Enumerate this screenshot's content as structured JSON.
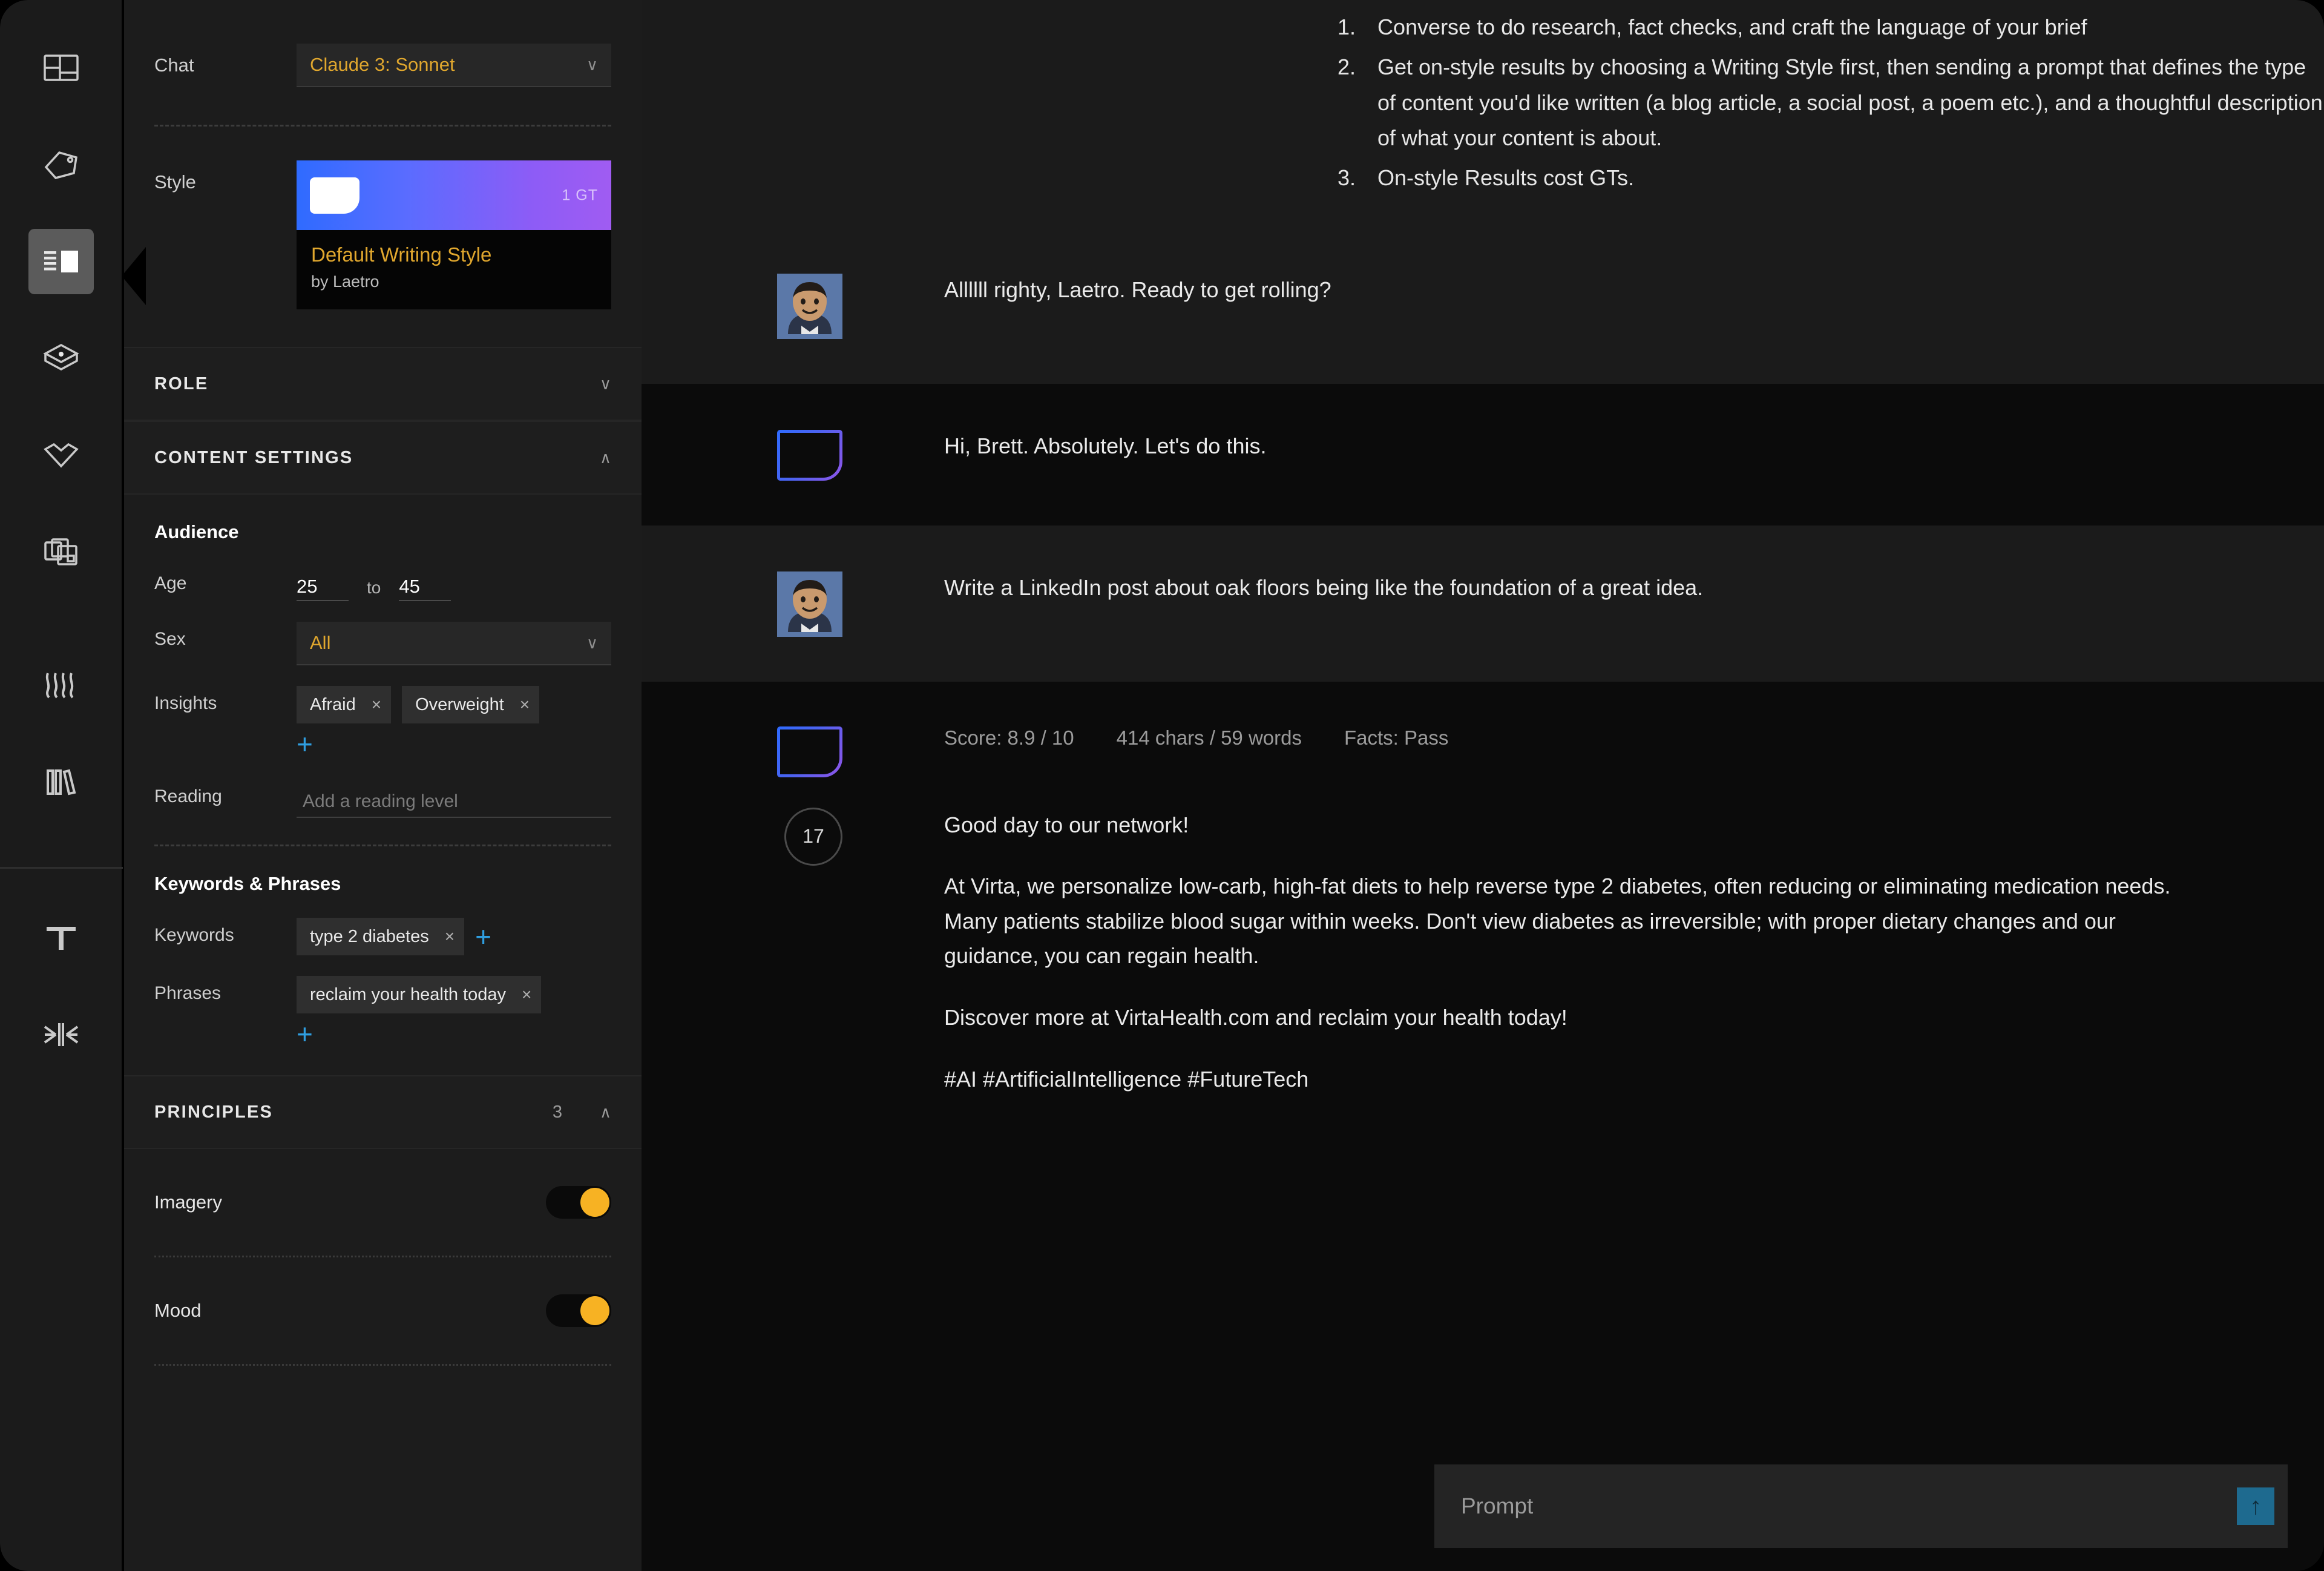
{
  "rail": {
    "items": [
      {
        "name": "layout-icon",
        "label": "Layout"
      },
      {
        "name": "tag-icon",
        "label": "Tag"
      },
      {
        "name": "panel-list-icon",
        "label": "Panel List",
        "active": true
      },
      {
        "name": "cube-icon",
        "label": "Cube"
      },
      {
        "name": "diamond-icon",
        "label": "Diamond"
      },
      {
        "name": "copy-icon",
        "label": "Copy"
      },
      {
        "name": "waves-icon",
        "label": "Waves"
      },
      {
        "name": "books-icon",
        "label": "Books"
      },
      {
        "name": "text-icon",
        "label": "Text"
      },
      {
        "name": "collapse-icon",
        "label": "Collapse"
      }
    ]
  },
  "panel": {
    "chat": {
      "label": "Chat",
      "model_value": "Claude 3: Sonnet",
      "chevron": "∨"
    },
    "style": {
      "label": "Style",
      "badge": "1 GT",
      "name": "Default Writing Style",
      "author": "by Laetro"
    },
    "sections": {
      "role": {
        "title": "ROLE",
        "caret": "∨"
      },
      "content_settings": {
        "title": "CONTENT SETTINGS",
        "caret": "∧"
      },
      "principles": {
        "title": "PRINCIPLES",
        "count": "3",
        "caret": "∧"
      }
    },
    "audience": {
      "title": "Audience",
      "age_label": "Age",
      "age_from": "25",
      "age_to_label": "to",
      "age_to": "45",
      "sex_label": "Sex",
      "sex_value": "All",
      "insights_label": "Insights",
      "insights": [
        "Afraid",
        "Overweight"
      ],
      "reading_label": "Reading",
      "reading_placeholder": "Add a reading level",
      "add_symbol": "+",
      "remove_symbol": "×"
    },
    "keywords": {
      "title": "Keywords & Phrases",
      "keywords_label": "Keywords",
      "keywords": [
        "type 2 diabetes"
      ],
      "phrases_label": "Phrases",
      "phrases": [
        "reclaim your health today"
      ]
    },
    "principles": [
      {
        "label": "Imagery",
        "on": true
      },
      {
        "label": "Mood",
        "on": true
      }
    ]
  },
  "chat": {
    "intro_items": [
      "Converse to do research, fact checks, and craft the language of your brief",
      "Get on-style results by choosing a Writing Style first, then sending a prompt that defines the type of content you'd like written (a blog article, a social post, a poem etc.), and a thoughtful description of what your content is about.",
      "On-style Results cost GTs."
    ],
    "messages": [
      {
        "role": "user",
        "text": "Allllll righty, Laetro. Ready to get rolling?"
      },
      {
        "role": "assistant",
        "text": "Hi, Brett. Absolutely. Let's do this."
      },
      {
        "role": "user",
        "text": "Write a LinkedIn post about oak floors being like the foundation of a great idea."
      }
    ],
    "result": {
      "stats": {
        "score": "Score: 8.9 / 10",
        "length": "414 chars / 59 words",
        "facts": "Facts: Pass"
      },
      "rank": "17",
      "paragraphs": [
        "Good day to our network!",
        "At Virta, we personalize low-carb, high-fat diets to help reverse type 2 diabetes, often reducing or eliminating medication needs. Many patients stabilize blood sugar within weeks. Don't view diabetes as irreversible; with proper dietary changes and our guidance, you can regain health.",
        "Discover more at VirtaHealth.com and reclaim your health today!",
        "#AI #ArtificialIntelligence #FutureTech"
      ]
    },
    "prompt": {
      "placeholder": "Prompt",
      "send_symbol": "↑"
    }
  },
  "colors": {
    "accent_gold": "#e0a72e",
    "accent_blue": "#2f9ee0",
    "toggle_on": "#f7b223",
    "send_button": "#1e6a8f"
  }
}
